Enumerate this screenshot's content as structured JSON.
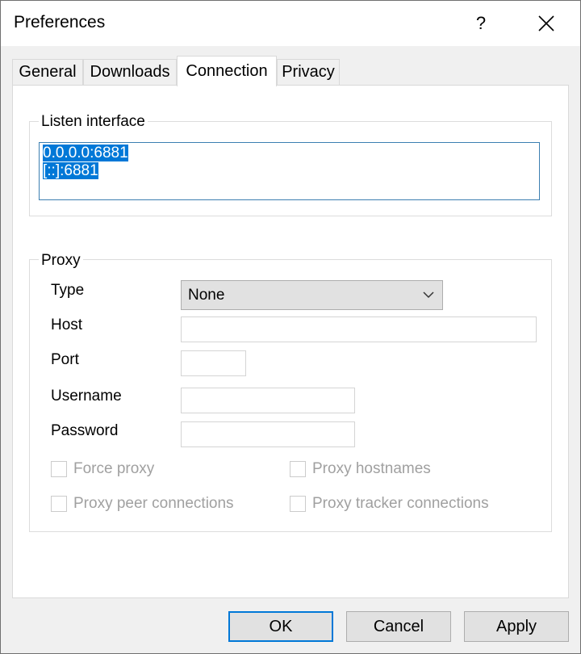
{
  "window": {
    "title": "Preferences",
    "help_label": "?"
  },
  "tabs": [
    {
      "label": "General"
    },
    {
      "label": "Downloads"
    },
    {
      "label": "Connection"
    },
    {
      "label": "Privacy"
    }
  ],
  "listen": {
    "group_label": "Listen interface",
    "items": [
      "0.0.0.0:6881",
      "[::]:6881"
    ]
  },
  "proxy": {
    "group_label": "Proxy",
    "type_label": "Type",
    "type_value": "None",
    "host_label": "Host",
    "port_label": "Port",
    "username_label": "Username",
    "password_label": "Password",
    "host_value": "",
    "port_value": "",
    "username_value": "",
    "password_value": "",
    "checkboxes": [
      {
        "label": "Force proxy",
        "checked": false
      },
      {
        "label": "Proxy hostnames",
        "checked": false
      },
      {
        "label": "Proxy peer connections",
        "checked": false
      },
      {
        "label": "Proxy tracker connections",
        "checked": false
      }
    ]
  },
  "buttons": {
    "ok": "OK",
    "cancel": "Cancel",
    "apply": "Apply"
  },
  "colors": {
    "selection": "#0078d7",
    "focus_border": "#0078d7",
    "disabled_text": "#a0a0a0"
  }
}
